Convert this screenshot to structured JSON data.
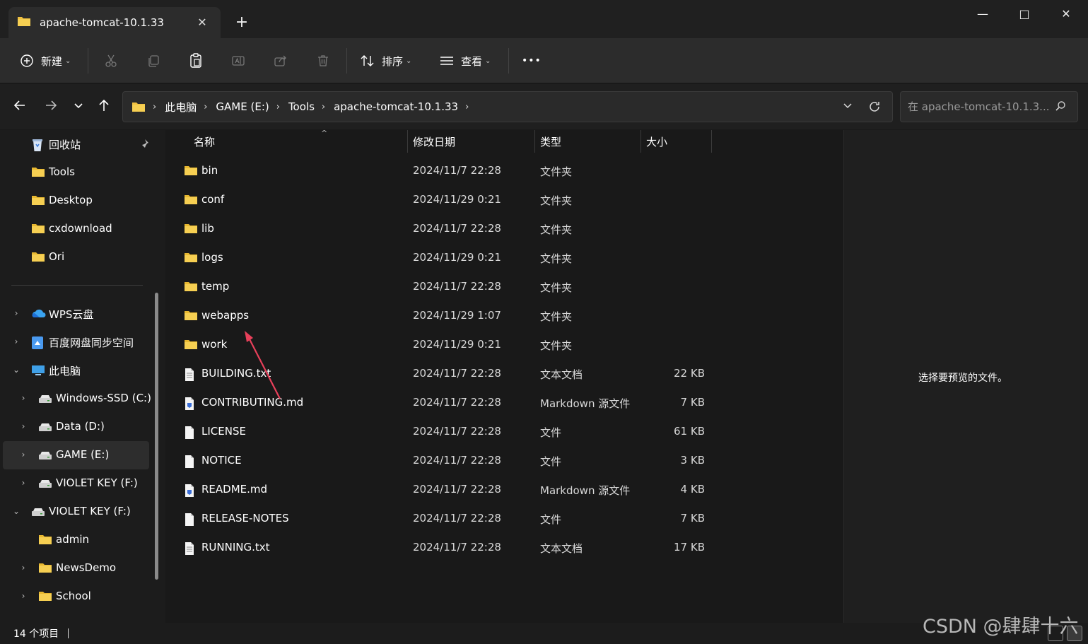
{
  "window": {
    "tab_title": "apache-tomcat-10.1.33",
    "new_tab_symbol": "+",
    "minimize_symbol": "—",
    "maximize_symbol": "□",
    "close_symbol": "✕"
  },
  "toolbar": {
    "new_label": "新建",
    "sort_label": "排序",
    "view_label": "查看",
    "more_symbol": "•••"
  },
  "address": {
    "breadcrumbs": [
      "此电脑",
      "GAME (E:)",
      "Tools",
      "apache-tomcat-10.1.33"
    ],
    "search_placeholder": "在 apache-tomcat-10.1.3..."
  },
  "sidebar": {
    "quick_access": [
      {
        "label": "回收站",
        "icon": "recycle-bin-icon",
        "pinned": true
      },
      {
        "label": "Tools",
        "icon": "folder-icon"
      },
      {
        "label": "Desktop",
        "icon": "folder-icon"
      },
      {
        "label": "cxdownload",
        "icon": "folder-icon"
      },
      {
        "label": "Ori",
        "icon": "folder-icon"
      }
    ],
    "tree": [
      {
        "label": "WPS云盘",
        "icon": "cloud-icon",
        "expander": "›"
      },
      {
        "label": "百度网盘同步空间",
        "icon": "baidu-icon",
        "expander": "›"
      },
      {
        "label": "此电脑",
        "icon": "pc-icon",
        "expander": "⌄"
      },
      {
        "label": "Windows-SSD (C:)",
        "icon": "drive-icon",
        "expander": "›"
      },
      {
        "label": "Data (D:)",
        "icon": "drive-icon",
        "expander": "›"
      },
      {
        "label": "GAME (E:)",
        "icon": "drive-icon",
        "expander": "›",
        "selected": true
      },
      {
        "label": "VIOLET KEY (F:)",
        "icon": "drive-icon",
        "expander": "›"
      },
      {
        "label": "VIOLET KEY (F:)",
        "icon": "drive-icon",
        "expander": "⌄"
      },
      {
        "label": "admin",
        "icon": "folder-icon",
        "expander": ""
      },
      {
        "label": "NewsDemo",
        "icon": "folder-icon",
        "expander": "›"
      },
      {
        "label": "School",
        "icon": "folder-icon",
        "expander": "›"
      }
    ]
  },
  "columns": {
    "name": "名称",
    "date": "修改日期",
    "type": "类型",
    "size": "大小"
  },
  "files": [
    {
      "name": "bin",
      "date": "2024/11/7 22:28",
      "type": "文件夹",
      "size": "",
      "kind": "folder"
    },
    {
      "name": "conf",
      "date": "2024/11/29 0:21",
      "type": "文件夹",
      "size": "",
      "kind": "folder"
    },
    {
      "name": "lib",
      "date": "2024/11/7 22:28",
      "type": "文件夹",
      "size": "",
      "kind": "folder"
    },
    {
      "name": "logs",
      "date": "2024/11/29 0:21",
      "type": "文件夹",
      "size": "",
      "kind": "folder"
    },
    {
      "name": "temp",
      "date": "2024/11/7 22:28",
      "type": "文件夹",
      "size": "",
      "kind": "folder"
    },
    {
      "name": "webapps",
      "date": "2024/11/29 1:07",
      "type": "文件夹",
      "size": "",
      "kind": "folder"
    },
    {
      "name": "work",
      "date": "2024/11/29 0:21",
      "type": "文件夹",
      "size": "",
      "kind": "folder"
    },
    {
      "name": "BUILDING.txt",
      "date": "2024/11/7 22:28",
      "type": "文本文档",
      "size": "22 KB",
      "kind": "text"
    },
    {
      "name": "CONTRIBUTING.md",
      "date": "2024/11/7 22:28",
      "type": "Markdown 源文件",
      "size": "7 KB",
      "kind": "markdown"
    },
    {
      "name": "LICENSE",
      "date": "2024/11/7 22:28",
      "type": "文件",
      "size": "61 KB",
      "kind": "file"
    },
    {
      "name": "NOTICE",
      "date": "2024/11/7 22:28",
      "type": "文件",
      "size": "3 KB",
      "kind": "file"
    },
    {
      "name": "README.md",
      "date": "2024/11/7 22:28",
      "type": "Markdown 源文件",
      "size": "4 KB",
      "kind": "markdown"
    },
    {
      "name": "RELEASE-NOTES",
      "date": "2024/11/7 22:28",
      "type": "文件",
      "size": "7 KB",
      "kind": "file"
    },
    {
      "name": "RUNNING.txt",
      "date": "2024/11/7 22:28",
      "type": "文本文档",
      "size": "17 KB",
      "kind": "text"
    }
  ],
  "preview": {
    "empty_text": "选择要预览的文件。"
  },
  "status": {
    "item_count": "14 个项目"
  },
  "watermark": "CSDN @肆肆十六",
  "colors": {
    "folder": "#f0c040",
    "accent": "#3a8ee6",
    "annotation_arrow": "#e8405a"
  }
}
